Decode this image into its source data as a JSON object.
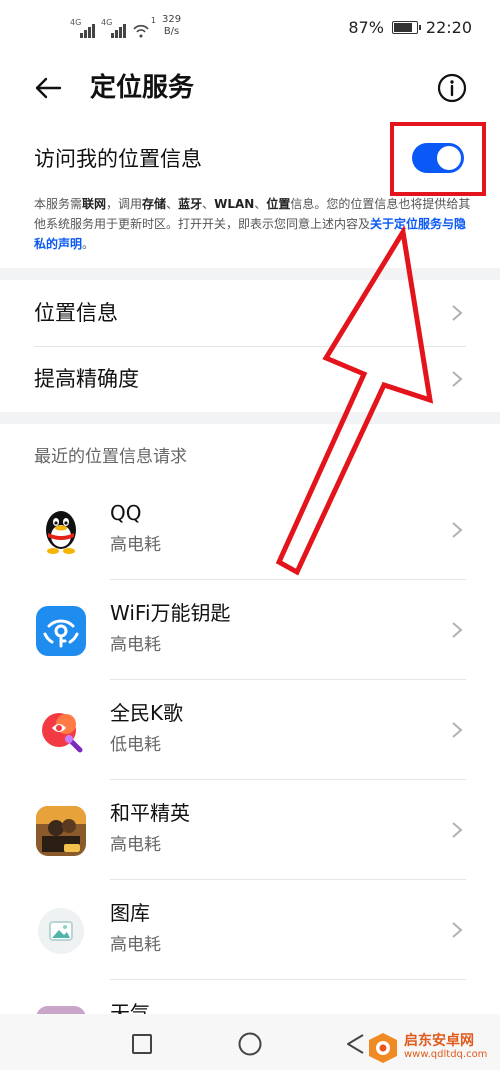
{
  "status_bar": {
    "net1": "4G",
    "net2": "4G",
    "wifi_badge": "1",
    "speed_value": "329",
    "speed_unit": "B/s",
    "battery": "87%",
    "battery_level": 0.87,
    "time": "22:20"
  },
  "header": {
    "title": "定位服务",
    "back_icon": "arrow-left-icon",
    "info_icon": "info-icon"
  },
  "location_access": {
    "label": "访问我的位置信息",
    "enabled": true,
    "accent_color": "#0a59f7",
    "description": {
      "p1": "本服务需",
      "b1": "联网",
      "p2": "，调用",
      "b2": "存储",
      "p3": "、",
      "b3": "蓝牙",
      "p4": "、",
      "b4": "WLAN",
      "p5": "、",
      "b5": "位置",
      "p6": "信息。您的位置信息也将提供给其他系统服务用于更新时区。打开开关，即表示您同意上述内容及",
      "link": "关于定位服务与隐私的声明",
      "p7": "。"
    }
  },
  "settings": {
    "items": [
      {
        "label": "位置信息"
      },
      {
        "label": "提高精确度"
      }
    ]
  },
  "recent": {
    "header": "最近的位置信息请求",
    "apps": [
      {
        "name": "QQ",
        "usage": "高电耗",
        "icon": "qq-penguin-icon"
      },
      {
        "name": "WiFi万能钥匙",
        "usage": "高电耗",
        "icon": "wifi-key-icon"
      },
      {
        "name": "全民K歌",
        "usage": "低电耗",
        "icon": "karaoke-icon"
      },
      {
        "name": "和平精英",
        "usage": "高电耗",
        "icon": "game-icon"
      },
      {
        "name": "图库",
        "usage": "高电耗",
        "icon": "gallery-icon"
      },
      {
        "name": "天气",
        "usage": "",
        "icon": "weather-icon"
      }
    ]
  },
  "navbar": {
    "recent_icon": "square-icon",
    "home_icon": "circle-icon",
    "back_icon": "triangle-back-icon"
  },
  "watermark": {
    "text": "启东安卓网",
    "url": "www.qdltdq.com"
  },
  "colors": {
    "highlight": "#e3141b",
    "link": "#0a59f7"
  }
}
